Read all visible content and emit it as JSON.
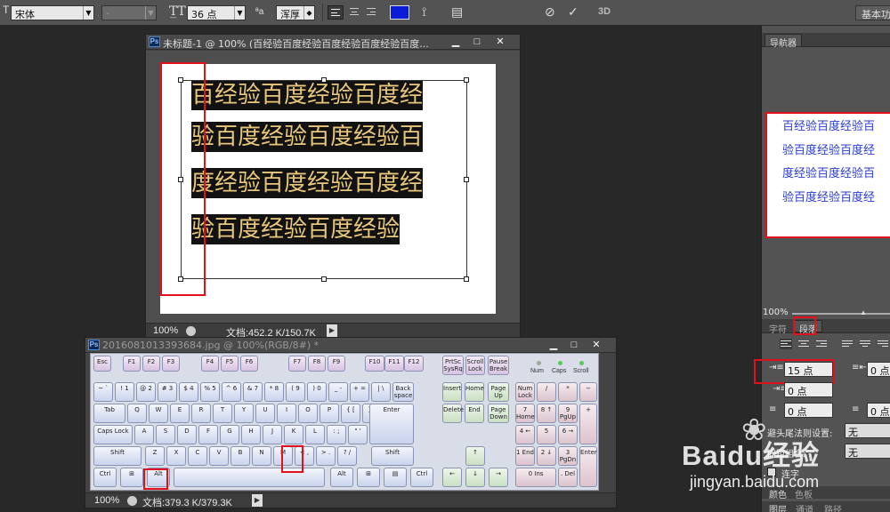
{
  "options_bar": {
    "font_family": "宋体",
    "font_style": "-",
    "font_size": "36 点",
    "aa_icon_label": "ªa",
    "antialias": "浑厚",
    "color_swatch": "#0a1cd8",
    "mode_3d": "3D",
    "workspace": "基本功"
  },
  "doc1": {
    "title": "未标题-1 @ 100% (百经验百度经验百度经验百度经验百度...",
    "canvas_lines": [
      "百经验百度经验百度经",
      "验百度经验百度经验百",
      "度经验百度经验百度经",
      "验百度经验百度经验"
    ],
    "zoom": "100%",
    "doc_info": "文档:452.2 K/150.7K"
  },
  "doc2": {
    "title": "2016081013393684.jpg @ 100%(RGB/8#) *",
    "zoom": "100%",
    "doc_info": "文档:379.3 K/379.3K"
  },
  "keyboard": {
    "indicators": [
      "Num",
      "Caps",
      "Scroll"
    ]
  },
  "navigator": {
    "tab": "导航器",
    "preview_lines": [
      "百经验百度经验百",
      "验百度经验百度经",
      "度经验百度经验百",
      "验百度经验百度经"
    ],
    "zoom": "100%"
  },
  "char_panel": {
    "tab_char": "字符",
    "tab_para": "段落",
    "indent_left": "15 点",
    "indent_right": "0 点",
    "indent_first": "0 点",
    "space_before": "0 点",
    "space_after": "0 点",
    "kinsoku_label": "避头尾法则设置:",
    "kinsoku_value": "无",
    "mojikumi_label": "间距组合:",
    "mojikumi_value": "无",
    "hyphen_label": "连字"
  },
  "bottom_tabs": {
    "color": "颜色",
    "swatches": "色板",
    "layers": "图层",
    "channels": "通道",
    "paths": "路径"
  },
  "watermark": {
    "brand": "Baidu经验",
    "url": "jingyan.baidu.com"
  }
}
